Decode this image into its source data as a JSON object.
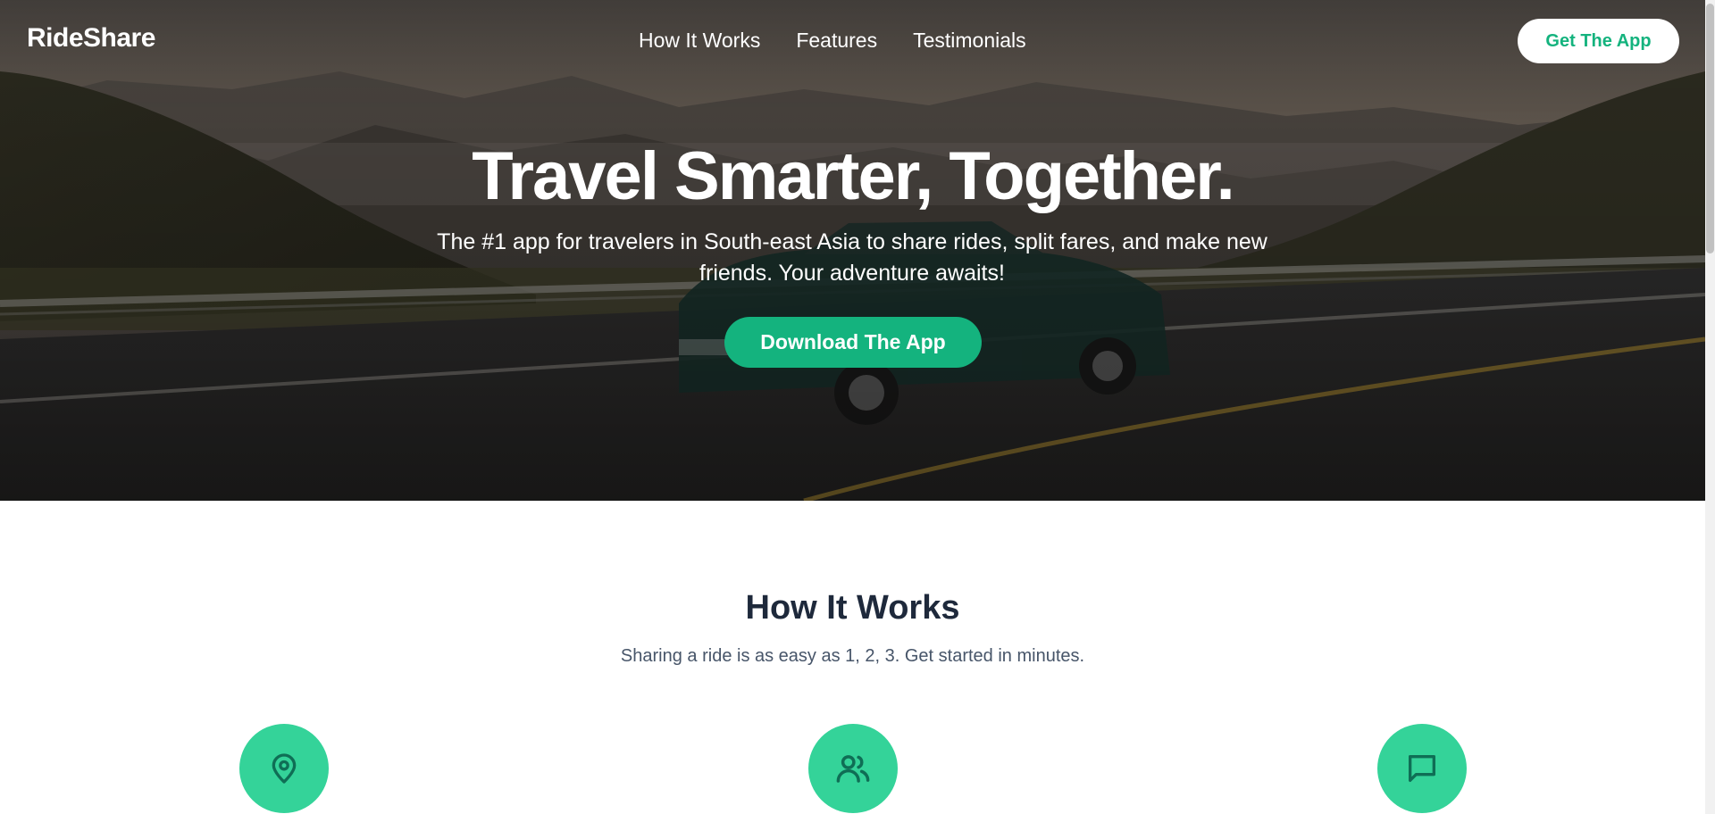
{
  "brand": {
    "name": "RideShare"
  },
  "nav": {
    "links": [
      "How It Works",
      "Features",
      "Testimonials"
    ],
    "cta_label": "Get The App"
  },
  "hero": {
    "title": "Travel Smarter, Together.",
    "subtitle": "The #1 app for travelers in South-east Asia to share rides, split fares, and make new friends. Your adventure awaits!",
    "cta_label": "Download The App",
    "background": "mountain road at dusk with a taxi"
  },
  "how_it_works": {
    "title": "How It Works",
    "subtitle": "Sharing a ride is as easy as 1, 2, 3. Get started in minutes.",
    "steps": [
      {
        "icon": "map-pin-icon"
      },
      {
        "icon": "users-icon"
      },
      {
        "icon": "chat-icon"
      }
    ]
  },
  "colors": {
    "accent": "#14b37e",
    "step_circle": "#34d399",
    "icon_stroke": "#0f6e55",
    "heading": "#1e293b",
    "body_text": "#475569"
  }
}
